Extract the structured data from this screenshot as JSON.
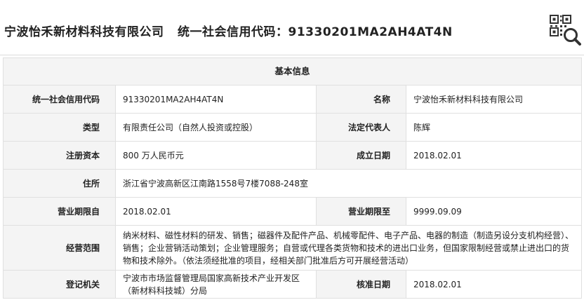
{
  "header": {
    "company_name": "宁波怡禾新材料科技有限公司",
    "credit_code_text": "统一社会信用代码：91330201MA2AH4AT4N",
    "qr_icon": "qr-search-icon"
  },
  "section_title": "基本信息",
  "rows": [
    {
      "l1": "统一社会信用代码",
      "v1": "91330201MA2AH4AT4N",
      "l2": "名称",
      "v2": "宁波怡禾新材料科技有限公司"
    },
    {
      "l1": "类型",
      "v1": "有限责任公司（自然人投资或控股）",
      "l2": "法定代表人",
      "v2": "陈辉"
    },
    {
      "l1": "注册资本",
      "v1": "800 万人民币元",
      "l2": "成立日期",
      "v2": "2018.02.01"
    },
    {
      "l1": "住所",
      "v1": "浙江省宁波高新区江南路1558号7楼7088-248室"
    },
    {
      "l1": "营业期限自",
      "v1": "2018.02.01",
      "l2": "营业期限至",
      "v2": "9999.09.09"
    },
    {
      "l1": "经营范围",
      "v1": "纳米材料、磁性材料的研发、销售；磁器件及配件产品、机械零配件、电子产品、电器的制造（制造另设分支机构经营）、销售；企业营销活动策划；企业管理服务；自营或代理各类货物和技术的进出口业务，但国家限制经营或禁止进出口的货物和技术除外。（依法须经批准的项目，经相关部门批准后方可开展经营活动）"
    },
    {
      "l1": "登记机关",
      "v1": "宁波市市场监督管理局国家高新技术产业开发区（新材料科技城）分局",
      "l2": "核准日期",
      "v2": "2018.02.01"
    }
  ]
}
